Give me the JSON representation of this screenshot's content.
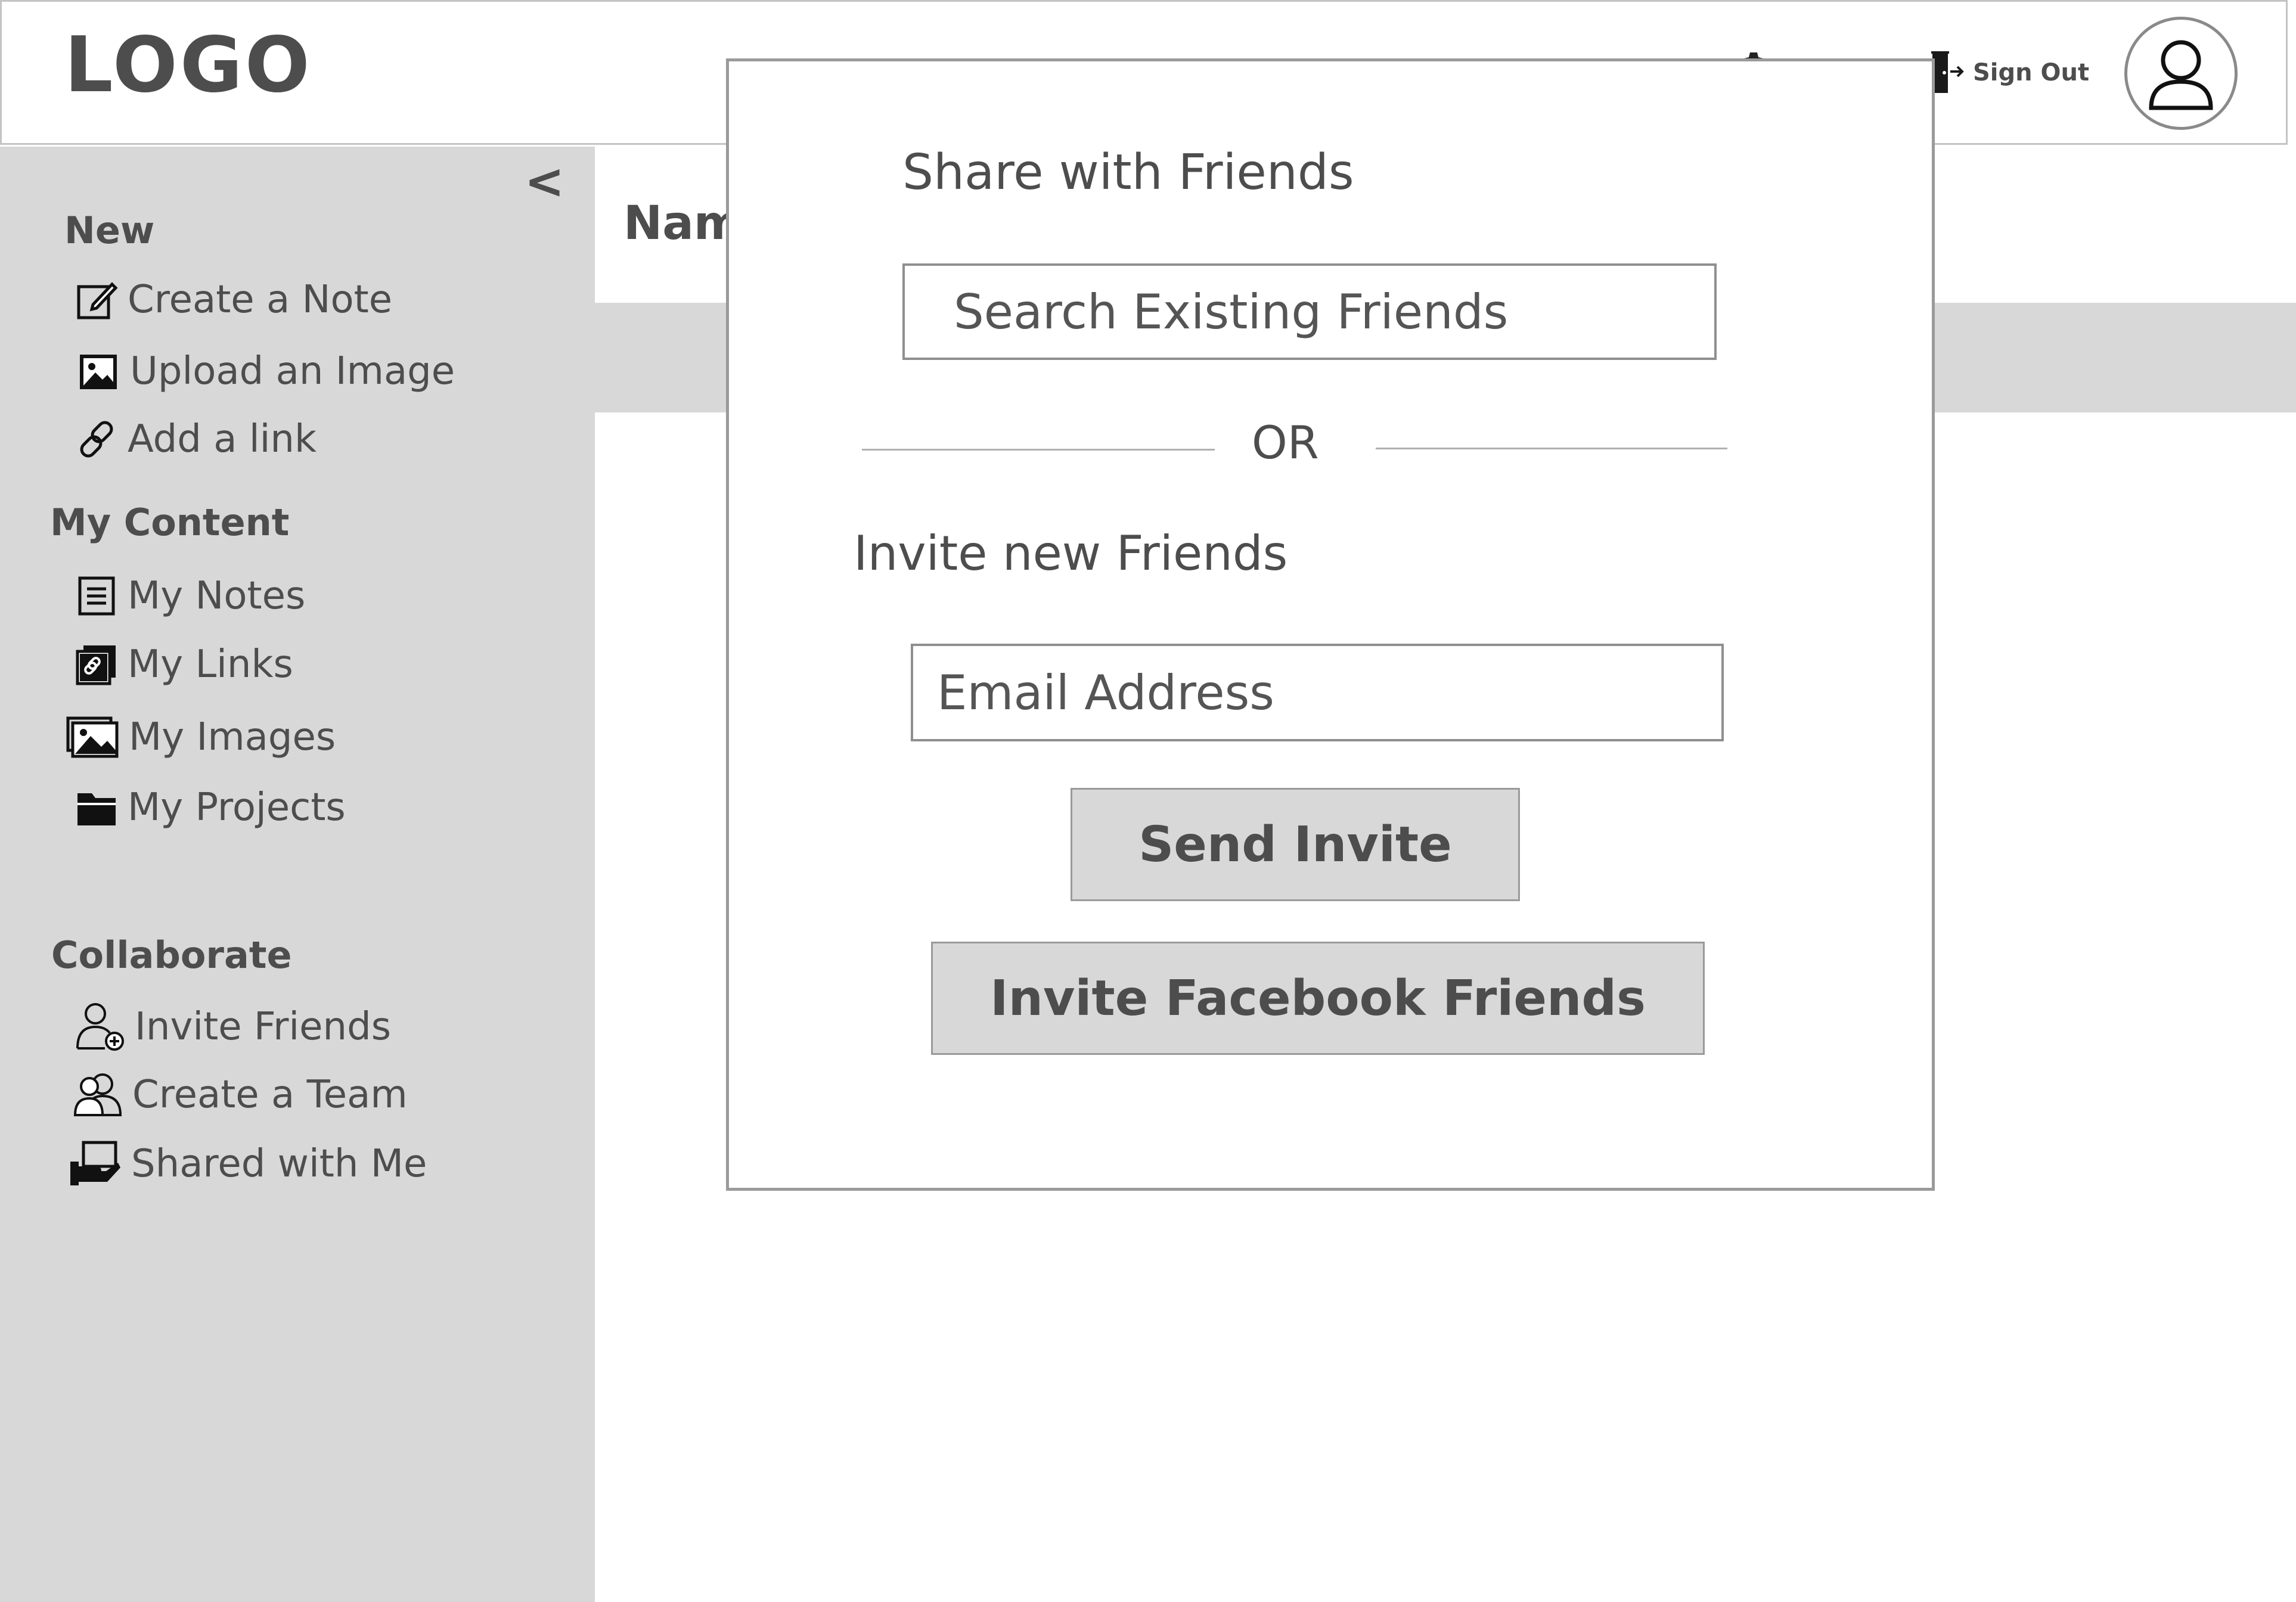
{
  "header": {
    "logo": "LOGO",
    "sign_out_label": "Sign Out"
  },
  "sidebar": {
    "collapse_glyph": "<",
    "sections": [
      {
        "title": "New",
        "items": [
          {
            "label": "Create a Note",
            "icon": "edit-note-icon"
          },
          {
            "label": "Upload an Image",
            "icon": "image-icon"
          },
          {
            "label": "Add a link",
            "icon": "link-icon"
          }
        ]
      },
      {
        "title": "My Content",
        "items": [
          {
            "label": "My Notes",
            "icon": "notes-icon"
          },
          {
            "label": "My Links",
            "icon": "links-icon"
          },
          {
            "label": "My Images",
            "icon": "images-icon"
          },
          {
            "label": "My Projects",
            "icon": "folder-icon"
          }
        ]
      },
      {
        "title": "Collaborate",
        "items": [
          {
            "label": "Invite Friends",
            "icon": "add-user-icon"
          },
          {
            "label": "Create a Team",
            "icon": "team-icon"
          },
          {
            "label": "Shared with Me",
            "icon": "shared-icon"
          }
        ]
      }
    ]
  },
  "main": {
    "column_header": "Nam"
  },
  "modal": {
    "title": "Share with Friends",
    "search_placeholder": "Search Existing Friends",
    "divider_text": "OR",
    "invite_title": "Invite new Friends",
    "email_placeholder": "Email Address",
    "send_button": "Send Invite",
    "facebook_button": "Invite Facebook Friends"
  }
}
